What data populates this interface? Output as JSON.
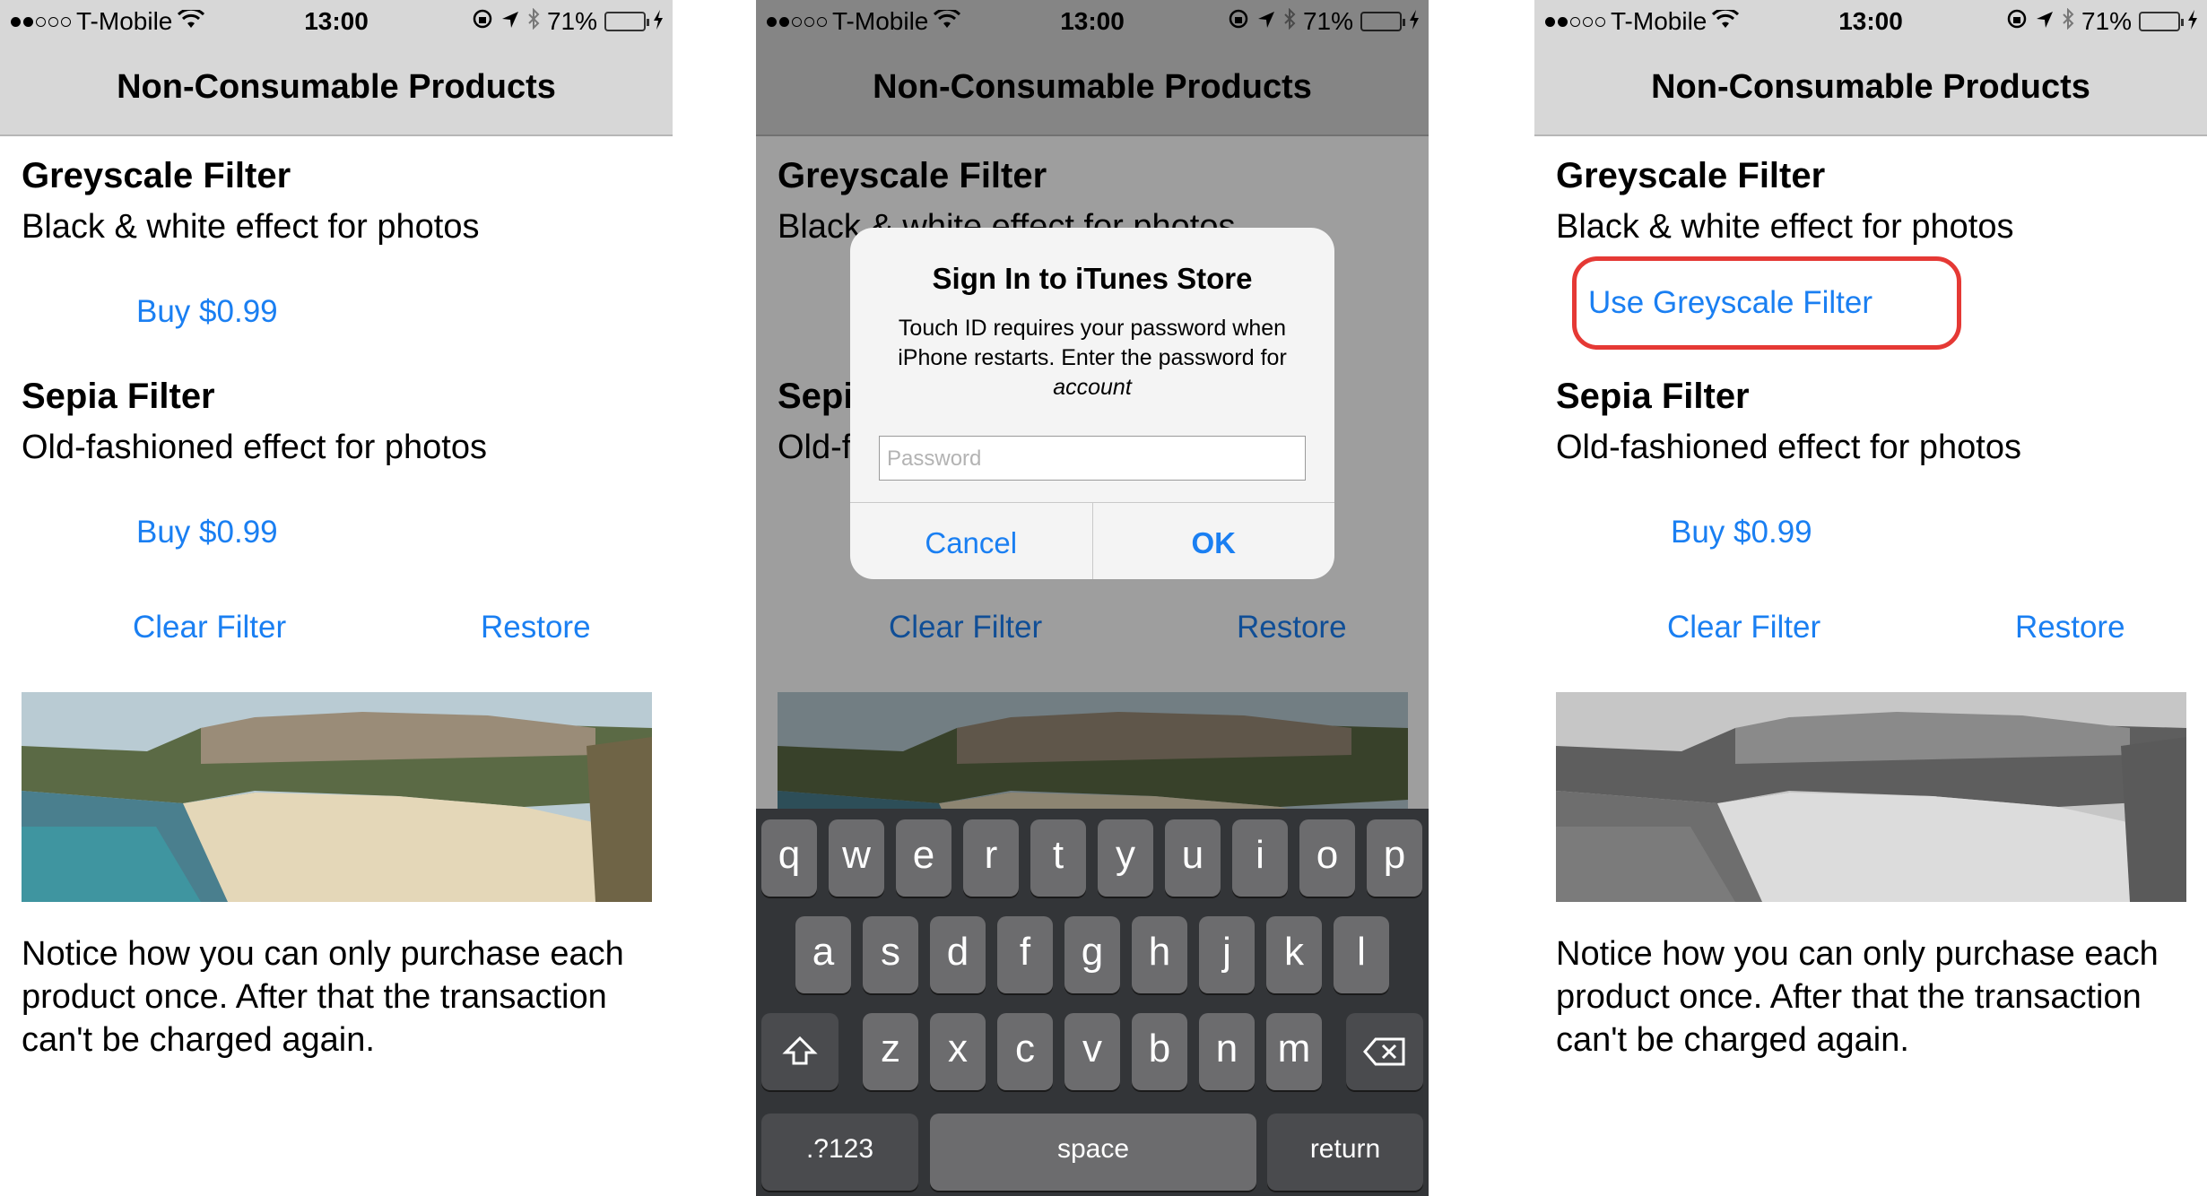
{
  "status": {
    "carrier": "T-Mobile",
    "time": "13:00",
    "battery": "71%",
    "battery_level": 0.71
  },
  "nav": {
    "title": "Non-Consumable Products"
  },
  "products": {
    "greyscale": {
      "title": "Greyscale Filter",
      "desc": "Black & white effect for photos",
      "buy": "Buy $0.99",
      "use": "Use Greyscale Filter"
    },
    "sepia": {
      "title": "Sepia Filter",
      "desc": "Old-fashioned effect for photos",
      "buy": "Buy $0.99"
    }
  },
  "actions": {
    "clear": "Clear Filter",
    "restore": "Restore"
  },
  "notice": "Notice how you can only purchase each product once. After that the transaction can't be charged again.",
  "dialog": {
    "title": "Sign In to iTunes Store",
    "message": "Touch ID requires your password when iPhone restarts. Enter the password for",
    "account": "account",
    "placeholder": "Password",
    "cancel": "Cancel",
    "ok": "OK"
  },
  "keyboard": {
    "row1": [
      "q",
      "w",
      "e",
      "r",
      "t",
      "y",
      "u",
      "i",
      "o",
      "p"
    ],
    "row2": [
      "a",
      "s",
      "d",
      "f",
      "g",
      "h",
      "j",
      "k",
      "l"
    ],
    "row3": [
      "z",
      "x",
      "c",
      "v",
      "b",
      "n",
      "m"
    ],
    "numbers": ".?123",
    "space": "space",
    "return": "return"
  },
  "colors": {
    "link": "#1a7ff2",
    "highlight": "#e53935",
    "battery": "#4cd964"
  },
  "icons": [
    "wifi-icon",
    "lock-rotation-icon",
    "location-arrow-icon",
    "bluetooth-icon",
    "battery-icon",
    "charging-bolt-icon",
    "shift-icon",
    "delete-icon"
  ]
}
